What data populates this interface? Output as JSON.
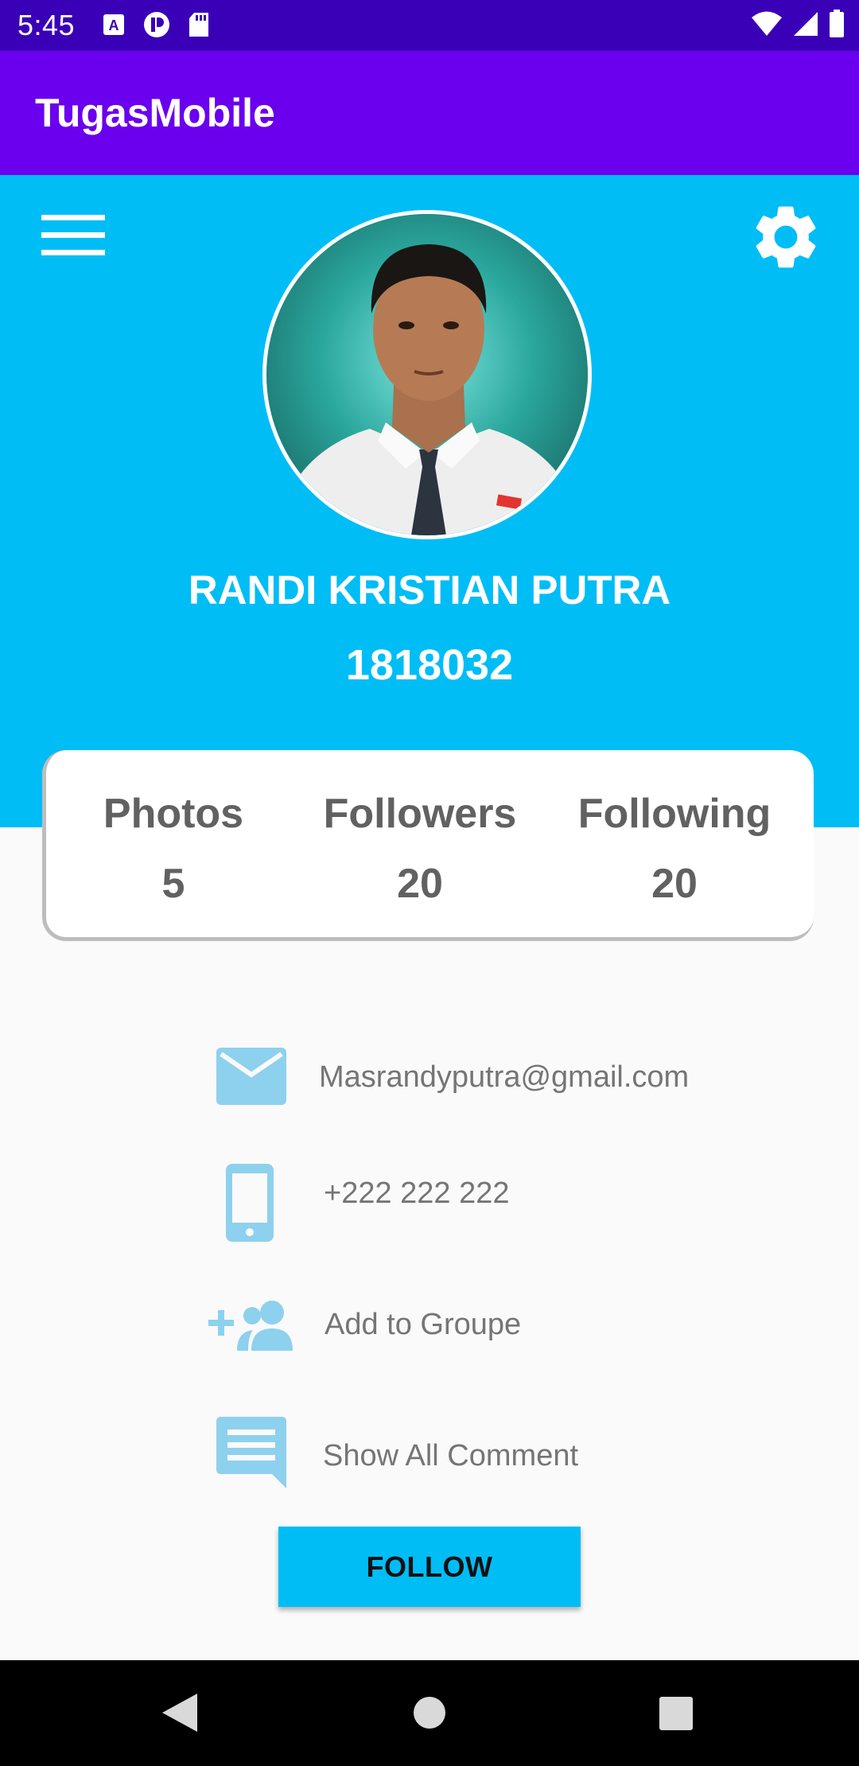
{
  "status_bar": {
    "time": "5:45",
    "left_icons": [
      "a-notification-icon",
      "p-notification-icon",
      "sd-card-icon"
    ],
    "right_icons": [
      "wifi-icon",
      "signal-icon",
      "battery-icon"
    ]
  },
  "app_bar": {
    "title": "TugasMobile"
  },
  "colors": {
    "status_bar": "#3a00b7",
    "app_bar": "#6a00ee",
    "header": "#00bdf6",
    "icon_blue": "#8dd1ee",
    "button": "#00bdf6"
  },
  "header": {
    "menu_icon": "hamburger-menu-icon",
    "settings_icon": "gear-icon",
    "name": "RANDI KRISTIAN PUTRA",
    "id": "1818032"
  },
  "stats": [
    {
      "label": "Photos",
      "value": "5"
    },
    {
      "label": "Followers",
      "value": "20"
    },
    {
      "label": "Following",
      "value": "20"
    }
  ],
  "contacts": [
    {
      "icon": "email-icon",
      "text": "Masrandyputra@gmail.com"
    },
    {
      "icon": "phone-icon",
      "text": "+222 222 222"
    },
    {
      "icon": "add-group-icon",
      "text": "Add to Groupe"
    },
    {
      "icon": "comment-icon",
      "text": "Show All Comment"
    }
  ],
  "follow_button": {
    "label": "FOLLOW"
  },
  "nav_bar": {
    "icons": [
      "back-icon",
      "home-icon",
      "recents-icon"
    ]
  }
}
